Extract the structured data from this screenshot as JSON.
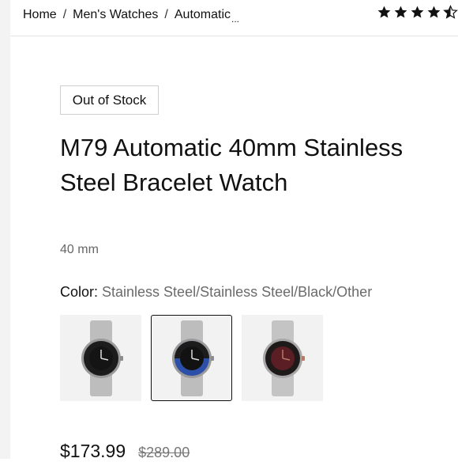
{
  "breadcrumb": {
    "items": [
      "Home",
      "Men's Watches",
      "Automatic"
    ],
    "separator": "/",
    "truncation": "..."
  },
  "rating": {
    "stars_filled": 4,
    "stars_partial": 0.5,
    "out_of": 5
  },
  "product": {
    "stock_badge": "Out of Stock",
    "title": "M79 Automatic 40mm Stainless Steel Bracelet Watch",
    "size": "40 mm",
    "color_label": "Color:",
    "color_value": " Stainless Steel/Stainless Steel/Black/Other",
    "swatches": [
      {
        "name": "black-bezel",
        "bezel": "#1c1c1c",
        "dial": "#141414",
        "accent": "#2a2a2a",
        "selected": false
      },
      {
        "name": "blue-black-bezel",
        "bezel": "#1c1c1c",
        "dial": "#121212",
        "accent": "#2c4fa8",
        "selected": true
      },
      {
        "name": "burgundy",
        "bezel": "#1f1a1a",
        "dial": "#5a1e24",
        "accent": "#b87a62",
        "selected": false
      }
    ],
    "price_current": "$173.99",
    "price_original": "$289.00"
  },
  "colors": {
    "text": "#111111",
    "muted": "#6b6b6b",
    "border": "#cfcfcf"
  }
}
